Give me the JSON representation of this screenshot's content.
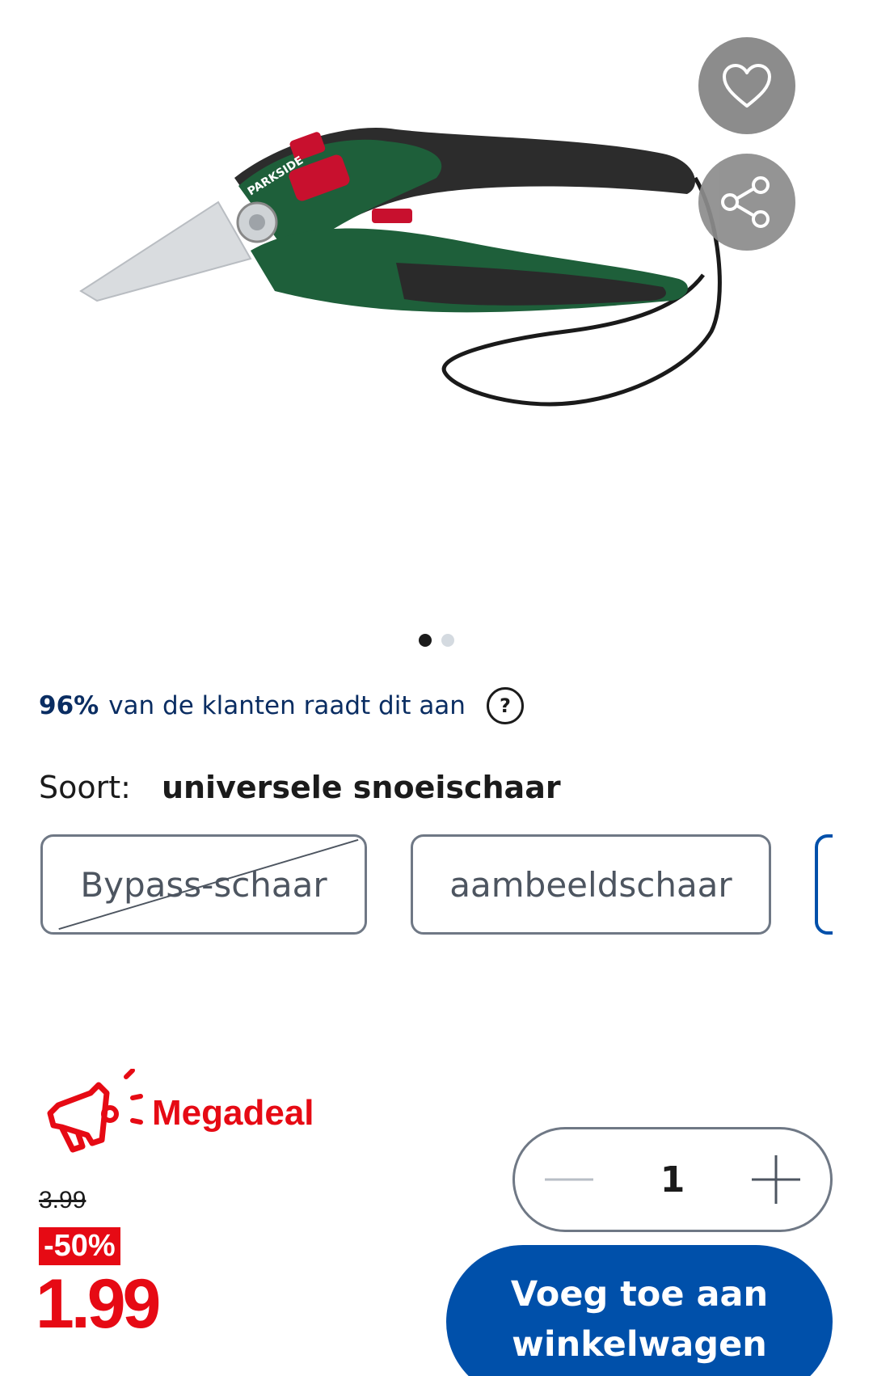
{
  "product": {
    "image_icon": "pruning-shears-image",
    "brand_label": "PARKSIDE"
  },
  "actions": {
    "favorite_icon": "heart-icon",
    "share_icon": "share-icon"
  },
  "gallery": {
    "slide_count": 2,
    "active_slide": 1
  },
  "recommendation": {
    "percent": "96%",
    "text": "van de klanten raadt dit aan",
    "help_symbol": "?"
  },
  "variant": {
    "label": "Soort:",
    "selected": "universele snoeischaar",
    "options": [
      {
        "label": "Bypass-schaar",
        "available": false
      },
      {
        "label": "aambeeldschaar",
        "available": true
      },
      {
        "label": "",
        "available": true,
        "selected": true
      }
    ]
  },
  "deal": {
    "label": "Megadeal",
    "icon": "megaphone-icon"
  },
  "pricing": {
    "old_price": "3.99",
    "discount": "-50%",
    "price": "1.99"
  },
  "quantity": {
    "value": "1",
    "minus_icon": "minus-icon",
    "plus_icon": "plus-icon"
  },
  "cart": {
    "button_label_line1": "Voeg toe aan",
    "button_label_line2": "winkelwagen"
  },
  "colors": {
    "brand_blue": "#0050aa",
    "deal_red": "#e60a14",
    "text_navy": "#0a2d62"
  }
}
